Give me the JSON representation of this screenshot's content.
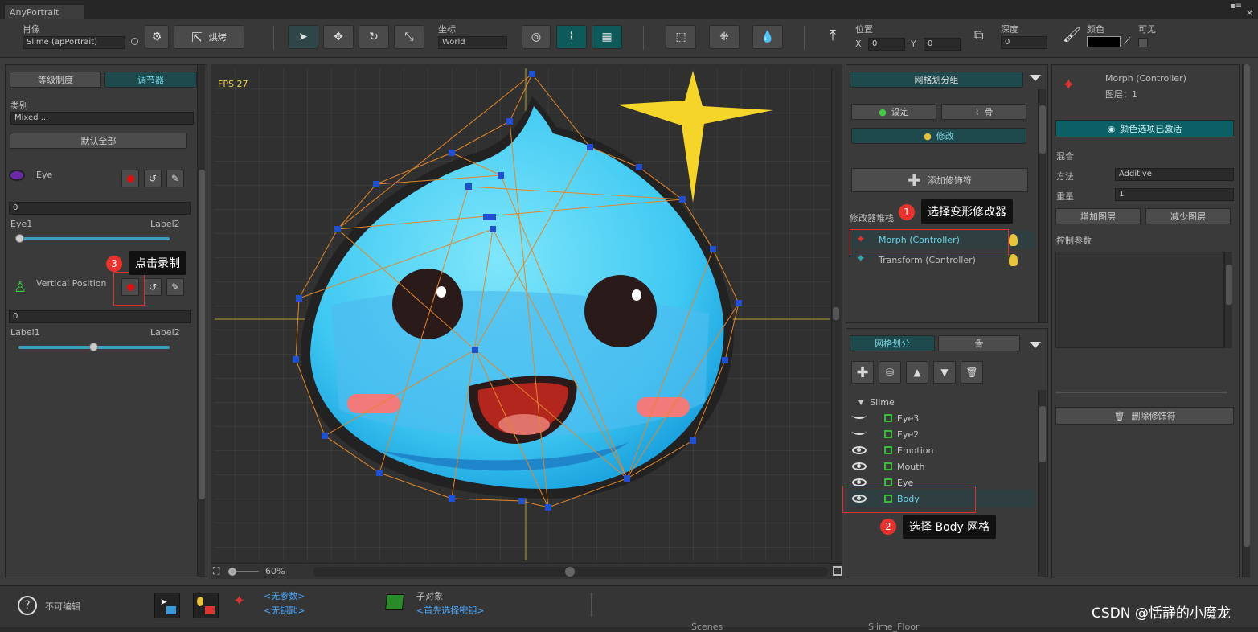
{
  "app": {
    "tab_title": "AnyPortrait",
    "watermark": "CSDN @恬静的小魔龙"
  },
  "toolbar": {
    "portrait_label": "肖像",
    "portrait_value": "Slime (apPortrait)",
    "bake_label": "烘烤",
    "coord_label": "坐标",
    "coord_value": "World",
    "position_label": "位置",
    "x_label": "X",
    "x_value": "0",
    "y_label": "Y",
    "y_value": "0",
    "depth_label": "深度",
    "depth_value": "0",
    "color_label": "颜色",
    "visible_label": "可见"
  },
  "left": {
    "tab_hierarchy": "等级制度",
    "tab_controller": "调节器",
    "category_label": "类别",
    "category_value": "Mixed ...",
    "default_all": "默认全部",
    "params": [
      {
        "name": "Eye",
        "value": "0",
        "label_left": "Eye1",
        "label_right": "Label2",
        "slider": 0.0
      },
      {
        "name": "Vertical Position",
        "value": "0",
        "label_left": "Label1",
        "label_right": "Label2",
        "slider": 0.5
      }
    ]
  },
  "viewport": {
    "fps": "FPS 27",
    "zoom": "60%"
  },
  "mesh_group": {
    "title": "网格划分组",
    "setting_btn": "设定",
    "bone_btn": "骨",
    "modify_btn": "修改",
    "add_modifier": "添加修饰符",
    "stack_label": "修改器堆栈",
    "modifiers": [
      "Morph (Controller)",
      "Transform (Controller)"
    ]
  },
  "mesh_list": {
    "tab_mesh": "网格划分",
    "tab_bone": "骨",
    "root": "Slime",
    "items": [
      "Eye3",
      "Eye2",
      "Emotion",
      "Mouth",
      "Eye",
      "Body"
    ]
  },
  "props": {
    "name": "Morph (Controller)",
    "layer": "图层：1",
    "color_active": "颜色选项已激活",
    "blend_label": "混合",
    "method_label": "方法",
    "method_value": "Additive",
    "weight_label": "重量",
    "weight_value": "1",
    "add_layer": "增加图层",
    "remove_layer": "减少图层",
    "ctrl_param_label": "控制参数",
    "delete_modifier": "删除修饰符"
  },
  "callouts": {
    "c1": "选择变形修改器",
    "c2": "选择 Body 网格",
    "c3": "点击录制",
    "n1": "1",
    "n2": "2",
    "n3": "3"
  },
  "status": {
    "not_editable": "不可编辑",
    "no_param": "<无参数>",
    "no_key": "<无钥匙>",
    "child_label": "子对象",
    "child_hint": "<首先选择密钥>",
    "scenes": "Scenes",
    "bottom_text": "Slime_Floor"
  }
}
